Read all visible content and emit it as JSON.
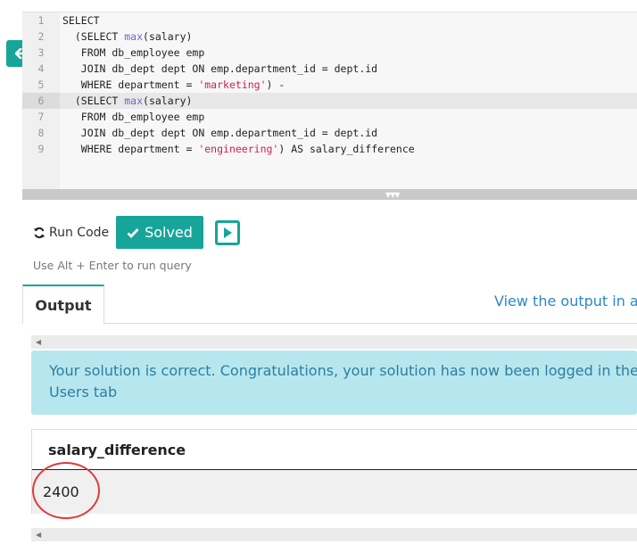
{
  "editor": {
    "lines": [
      {
        "num": "1",
        "parts": [
          {
            "t": "SELECT"
          }
        ]
      },
      {
        "num": "2",
        "parts": [
          {
            "t": "  (SELECT "
          },
          {
            "t": "max",
            "c": "kw-fn"
          },
          {
            "t": "(salary)"
          }
        ]
      },
      {
        "num": "3",
        "parts": [
          {
            "t": "   FROM db_employee emp"
          }
        ]
      },
      {
        "num": "4",
        "parts": [
          {
            "t": "   JOIN db_dept dept ON emp.department_id = dept.id"
          }
        ]
      },
      {
        "num": "5",
        "parts": [
          {
            "t": "   WHERE department = "
          },
          {
            "t": "'marketing'",
            "c": "str"
          },
          {
            "t": ") -"
          }
        ]
      },
      {
        "num": "6",
        "parts": [
          {
            "t": "  (SELECT "
          },
          {
            "t": "max",
            "c": "kw-fn"
          },
          {
            "t": "(salary)"
          }
        ],
        "active": true
      },
      {
        "num": "7",
        "parts": [
          {
            "t": "   FROM db_employee emp"
          }
        ]
      },
      {
        "num": "8",
        "parts": [
          {
            "t": "   JOIN db_dept dept ON emp.department_id = dept.id"
          }
        ]
      },
      {
        "num": "9",
        "parts": [
          {
            "t": "   WHERE department = "
          },
          {
            "t": "'engineering'",
            "c": "str"
          },
          {
            "t": ") AS salary_difference"
          }
        ]
      }
    ],
    "resize_grip": "▼▼▼"
  },
  "toolbar": {
    "run_code_label": "Run Code",
    "solved_label": "Solved",
    "hint": "Use Alt + Enter to run query",
    "icons": {
      "back": "arrow-left-icon",
      "refresh": "refresh-icon",
      "check": "check-icon",
      "play": "play-icon"
    }
  },
  "output": {
    "tab_label": "Output",
    "view_link": "View the output in a",
    "alert_line1": "Your solution is correct. Congratulations, your solution has now been logged in the So",
    "alert_line2": "Users tab",
    "table": {
      "columns": [
        "salary_difference"
      ],
      "rows": [
        [
          "2400"
        ]
      ]
    }
  },
  "colors": {
    "accent": "#17a599",
    "alert_bg": "#b7e7ee",
    "annotation": "#e03b3b"
  }
}
